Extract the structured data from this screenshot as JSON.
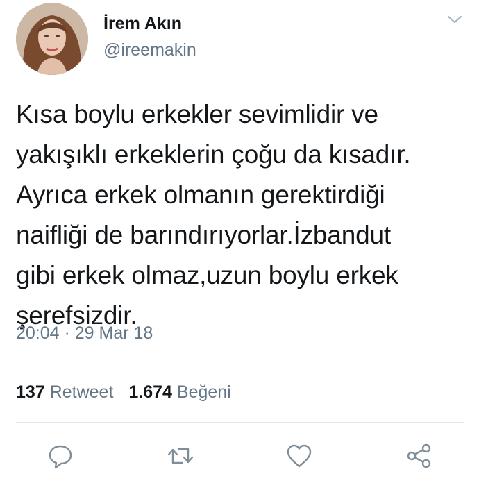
{
  "user": {
    "name": "İrem Akın",
    "handle": "@ireemakin",
    "avatar_icon": "profile-photo"
  },
  "tweet": {
    "lines": [
      "Kısa boylu erkekler sevimlidir ve",
      "yakışıklı erkeklerin çoğu da kısadır.",
      "Ayrıca erkek olmanın gerektirdiği",
      "naifliği de barındırıyorlar.İzbandut",
      "gibi erkek olmaz,uzun boylu erkek",
      "şerefsizdir."
    ],
    "timestamp": "20:04 · 29 Mar 18"
  },
  "stats": {
    "retweets_count": "137",
    "retweets_label": "Retweet",
    "likes_count": "1.674",
    "likes_label": "Beğeni"
  },
  "actions": {
    "icons": [
      "reply-icon",
      "retweet-icon",
      "like-icon",
      "share-icon"
    ]
  },
  "colors": {
    "text": "#14171a",
    "secondary": "#657786",
    "divider": "#e1e8ed",
    "icon": "#7f8d99"
  }
}
